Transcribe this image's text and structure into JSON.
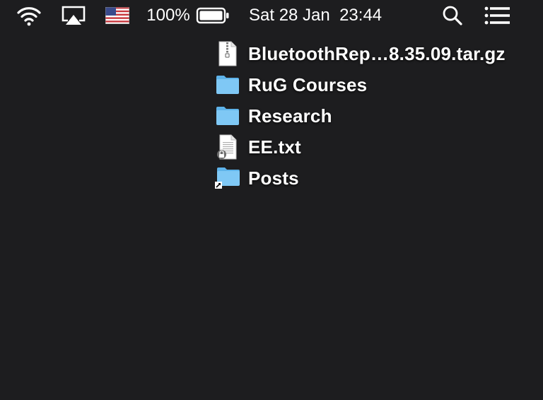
{
  "menubar": {
    "icons": {
      "wifi": "wifi-icon",
      "airplay": "airplay-icon",
      "input_source": "us-flag-icon",
      "battery": "battery-icon",
      "spotlight": "search-icon",
      "notification_center": "list-icon"
    },
    "battery_percent": "100%",
    "battery_level": 1.0,
    "clock": "Sat 28 Jan  23:44"
  },
  "desktop": {
    "items": [
      {
        "label": "BluetoothRep…8.35.09.tar.gz",
        "icon": "archive-file-icon"
      },
      {
        "label": "RuG Courses",
        "icon": "folder-icon"
      },
      {
        "label": "Research",
        "icon": "folder-icon"
      },
      {
        "label": "EE.txt",
        "icon": "locked-text-file-icon"
      },
      {
        "label": "Posts",
        "icon": "folder-alias-icon"
      }
    ]
  },
  "colors": {
    "background": "#1d1d1f",
    "folder_light": "#7fc8f5",
    "folder_dark": "#5eb3ea",
    "text": "#ffffff"
  }
}
